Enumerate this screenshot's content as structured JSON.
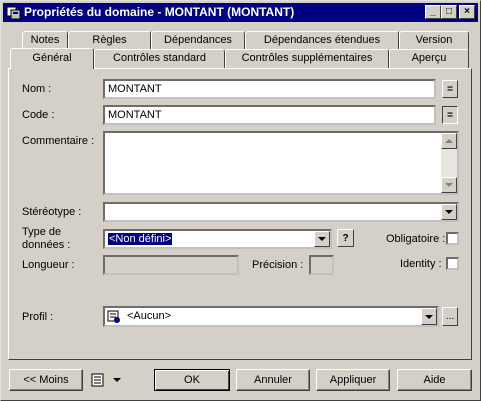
{
  "window": {
    "title": "Propriétés du domaine - MONTANT (MONTANT)"
  },
  "caption_buttons": {
    "minimize": "_",
    "maximize": "□",
    "close": "×"
  },
  "tabs_row1": [
    "Notes",
    "Règles",
    "Dépendances",
    "Dépendances étendues",
    "Version"
  ],
  "tabs_row2": [
    "Général",
    "Contrôles standard",
    "Contrôles supplémentaires",
    "Aperçu"
  ],
  "active_tab": "Général",
  "form": {
    "nom_label": "Nom :",
    "nom_value": "MONTANT",
    "code_label": "Code :",
    "code_value": "MONTANT",
    "equals_symbol": "=",
    "commentaire_label": "Commentaire :",
    "commentaire_value": "",
    "stereotype_label": "Stéréotype :",
    "stereotype_value": "",
    "type_label_line1": "Type de",
    "type_label_line2": "données :",
    "type_value": "<Non défini>",
    "type_help": "?",
    "obligatoire_label": "Obligatoire :",
    "longueur_label": "Longueur :",
    "precision_label": "Précision :",
    "identity_label": "Identity :",
    "profil_label": "Profil :",
    "profil_value": "<Aucun>",
    "ellipsis": "..."
  },
  "buttons": {
    "moins": "<< Moins",
    "ok": "OK",
    "annuler": "Annuler",
    "appliquer": "Appliquer",
    "aide": "Aide"
  },
  "icons": [
    "app-icon",
    "list-menu-icon",
    "dropdown-arrow-icon",
    "profile-icon"
  ]
}
